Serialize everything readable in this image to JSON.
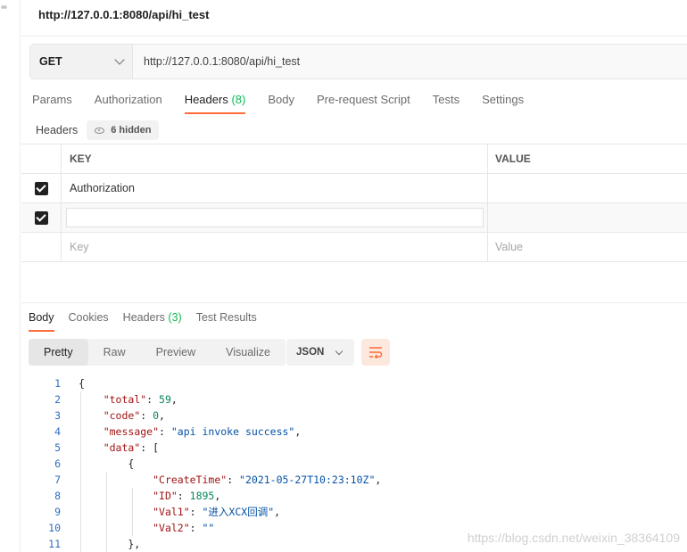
{
  "request": {
    "title": "http://127.0.0.1:8080/api/hi_test",
    "method": "GET",
    "url": "http://127.0.0.1:8080/api/hi_test"
  },
  "request_tabs": [
    {
      "label": "Params"
    },
    {
      "label": "Authorization"
    },
    {
      "label": "Headers",
      "count": "(8)"
    },
    {
      "label": "Body"
    },
    {
      "label": "Pre-request Script"
    },
    {
      "label": "Tests"
    },
    {
      "label": "Settings"
    }
  ],
  "headers_section": {
    "label": "Headers",
    "hidden": "6 hidden"
  },
  "kv_table": {
    "key_header": "KEY",
    "value_header": "VALUE",
    "rows": [
      {
        "key": "Authorization",
        "value": ""
      },
      {
        "key": "",
        "value": ""
      }
    ],
    "key_placeholder": "Key",
    "value_placeholder": "Value"
  },
  "response_tabs": [
    {
      "label": "Body"
    },
    {
      "label": "Cookies"
    },
    {
      "label": "Headers",
      "count": "(3)"
    },
    {
      "label": "Test Results"
    }
  ],
  "view_modes": [
    "Pretty",
    "Raw",
    "Preview",
    "Visualize"
  ],
  "format": "JSON",
  "code_lines": [
    "1",
    "2",
    "3",
    "4",
    "5",
    "6",
    "7",
    "8",
    "9",
    "10",
    "11"
  ],
  "json": {
    "total_key": "\"total\"",
    "total_val": "59",
    "code_key": "\"code\"",
    "code_val": "0",
    "message_key": "\"message\"",
    "message_val": "\"api invoke success\"",
    "data_key": "\"data\"",
    "createtime_key": "\"CreateTime\"",
    "createtime_val": "\"2021-05-27T10:23:10Z\"",
    "id_key": "\"ID\"",
    "id_val": "1895",
    "val1_key": "\"Val1\"",
    "val1_val": "\"进入XCX回调\"",
    "val2_key": "\"Val2\"",
    "val2_val": "\"\""
  },
  "watermark": "https://blog.csdn.net/weixin_38364109",
  "colors": {
    "accent": "#ff6c37",
    "count": "#0cbb52"
  }
}
